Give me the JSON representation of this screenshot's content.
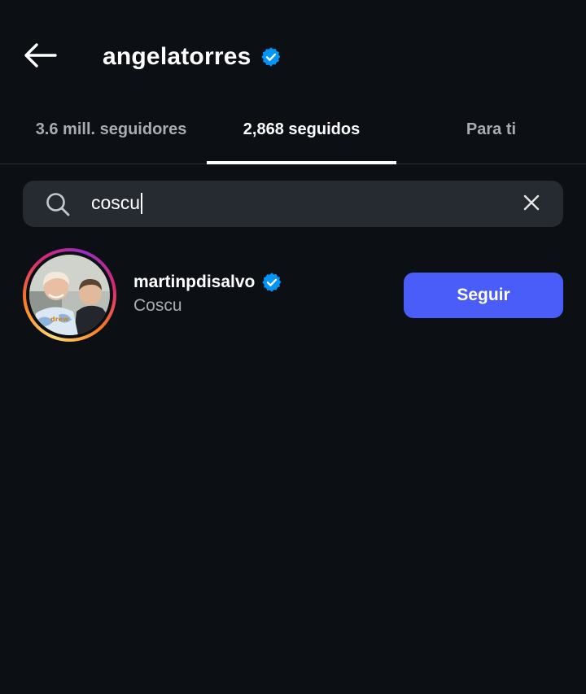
{
  "header": {
    "back_icon": "arrow-left-icon",
    "title": "angelatorres",
    "verified_icon": "verified-badge-icon",
    "verified_color": "#0095f6"
  },
  "tabs": [
    {
      "label": "3.6 mill. seguidores",
      "active": false
    },
    {
      "label": "2,868 seguidos",
      "active": true
    },
    {
      "label": "Para ti",
      "active": false
    }
  ],
  "search": {
    "icon": "search-icon",
    "value": "coscu",
    "clear_icon": "close-icon"
  },
  "results": [
    {
      "username": "martinpdisalvo",
      "verified": true,
      "full_name": "Coscu",
      "follow_label": "Seguir",
      "avatar_text": "drew"
    }
  ],
  "colors": {
    "background": "#0c0f14",
    "search_bg": "#262a31",
    "follow_button": "#4a5df9",
    "muted_text": "#a8acb3"
  }
}
